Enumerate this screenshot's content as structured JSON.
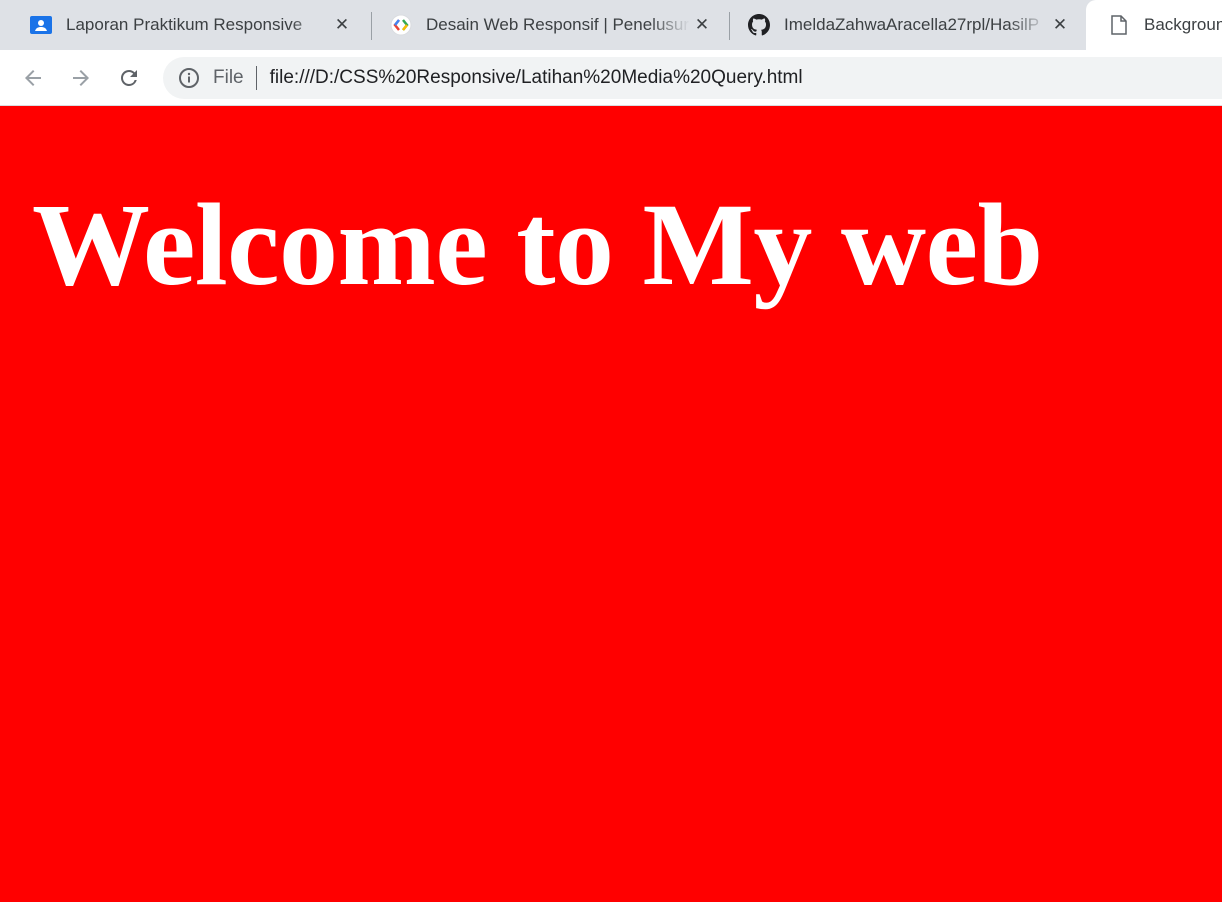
{
  "browser": {
    "tabs": [
      {
        "title": "Laporan Praktikum Responsive",
        "icon": "google-classroom-icon"
      },
      {
        "title": "Desain Web Responsif | Penelusuran",
        "icon": "google-developers-icon"
      },
      {
        "title": "ImeldaZahwaAracella27rpl/HasilP",
        "icon": "github-icon"
      },
      {
        "title": "Backgroun",
        "icon": "file-icon"
      }
    ],
    "close_glyph": "✕",
    "omnibox": {
      "label": "File",
      "url": "file:///D:/CSS%20Responsive/Latihan%20Media%20Query.html"
    }
  },
  "page": {
    "heading": "Welcome to My web",
    "background_color": "#ff0000",
    "text_color": "#ffffff"
  }
}
